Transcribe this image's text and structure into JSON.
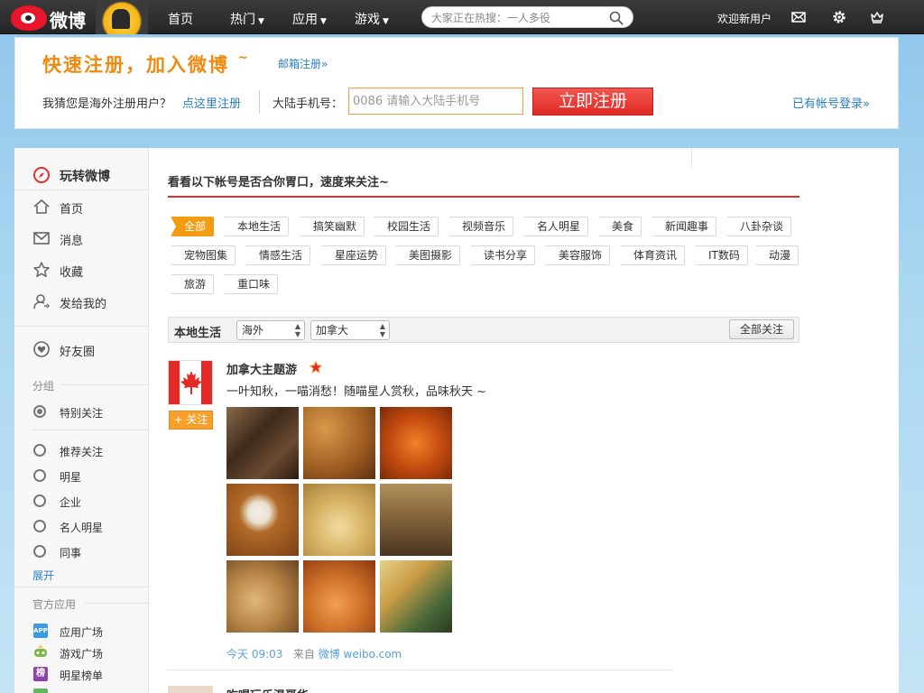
{
  "header": {
    "logo_text": "微博",
    "nav": [
      {
        "label": "首页",
        "has_dropdown": false
      },
      {
        "label": "热门",
        "has_dropdown": true
      },
      {
        "label": "应用",
        "has_dropdown": true
      },
      {
        "label": "游戏",
        "has_dropdown": true
      }
    ],
    "search_placeholder": "大家正在热搜：一人多役",
    "welcome": "欢迎新用户",
    "icons": [
      "mail-icon",
      "gear-icon",
      "crown-icon"
    ]
  },
  "register": {
    "title": "快速注册，加入微博",
    "title_suffix": "~",
    "email_link": "邮箱注册»",
    "oversea_text": "我猜您是海外注册用户？",
    "oversea_link": "点这里注册",
    "phone_label": "大陆手机号：",
    "phone_placeholder": "0086 请输入大陆手机号",
    "submit": "立即注册",
    "login_link": "已有帐号登录»"
  },
  "sidebar": {
    "main_items": [
      {
        "label": "玩转微博",
        "icon": "compass-icon",
        "active": true
      },
      {
        "label": "首页",
        "icon": "home-icon",
        "active": false
      },
      {
        "label": "消息",
        "icon": "envelope-icon",
        "active": false
      },
      {
        "label": "收藏",
        "icon": "star-icon",
        "active": false
      },
      {
        "label": "发给我的",
        "icon": "user-share-icon",
        "active": false
      }
    ],
    "friends": {
      "label": "好友圈",
      "icon": "heart-circle-icon"
    },
    "group_title": "分组",
    "special": {
      "label": "特别关注"
    },
    "groups": [
      "推荐关注",
      "明星",
      "企业",
      "名人明星",
      "同事"
    ],
    "expand": "展开",
    "apps_title": "官方应用",
    "apps": [
      {
        "label": "应用广场",
        "icon": "app-square-icon",
        "icon_text": "APP",
        "color": "#3a9be0"
      },
      {
        "label": "游戏广场",
        "icon": "game-square-icon",
        "icon_text": "",
        "color": "#7ab648"
      },
      {
        "label": "明星榜单",
        "icon": "star-rank-icon",
        "icon_text": "榜",
        "color": "#8e44ad"
      }
    ]
  },
  "content": {
    "title": "看看以下帐号是否合你胃口，速度来关注~",
    "tags": [
      "全部",
      "本地生活",
      "搞笑幽默",
      "校园生活",
      "视频音乐",
      "名人明星",
      "美食",
      "新闻趣事",
      "八卦杂谈",
      "宠物图集",
      "情感生活",
      "星座运势",
      "美图摄影",
      "读书分享",
      "美容服饰",
      "体育资讯",
      "IT数码",
      "动漫",
      "旅游",
      "重口味"
    ],
    "active_tag": "全部",
    "filter": {
      "title": "本地生活",
      "region1": "海外",
      "region2": "加拿大",
      "follow_all": "全部关注"
    },
    "feed": {
      "name": "加拿大主题游",
      "text": "一叶知秋，一喵消愁！随喵星人赏秋，品味秋天 ~",
      "follow": "+ 关注",
      "time": "今天 09:03",
      "from_label": "来自",
      "source": "微博 weibo.com",
      "photos": [
        {
          "name": "cat-window-photo",
          "bg": "#6b4a30"
        },
        {
          "name": "leaves-cat-photo",
          "bg": "#a8662a"
        },
        {
          "name": "orange-cat-leaves-photo",
          "bg": "#c44b10"
        },
        {
          "name": "white-cat-leaves-photo",
          "bg": "#b26a28"
        },
        {
          "name": "cat-golden-leaves-photo",
          "bg": "#d8b467"
        },
        {
          "name": "tabby-cat-photo",
          "bg": "#8a6a3e"
        },
        {
          "name": "cat-sleeping-leaves-photo",
          "bg": "#b88648"
        },
        {
          "name": "kitten-leaves-photo",
          "bg": "#d0722a"
        },
        {
          "name": "cat-window-sun-photo",
          "bg": "#c99c45"
        }
      ]
    },
    "next_feed_name": "吃喝玩乐温哥华"
  }
}
